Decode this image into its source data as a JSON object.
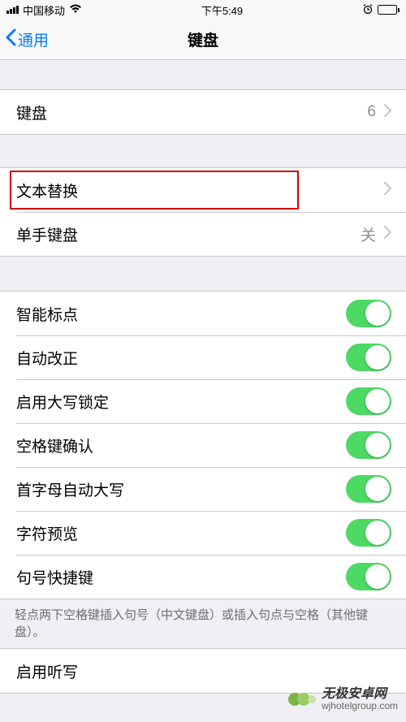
{
  "status_bar": {
    "carrier": "中国移动",
    "time": "下午5:49"
  },
  "nav": {
    "back_label": "通用",
    "title": "键盘"
  },
  "group1": {
    "keyboards": {
      "label": "键盘",
      "value": "6"
    }
  },
  "group2": {
    "text_replace": {
      "label": "文本替换"
    },
    "one_handed": {
      "label": "单手键盘",
      "value": "关"
    }
  },
  "group3": {
    "items": [
      {
        "label": "智能标点"
      },
      {
        "label": "自动改正"
      },
      {
        "label": "启用大写锁定"
      },
      {
        "label": "空格键确认"
      },
      {
        "label": "首字母自动大写"
      },
      {
        "label": "字符预览"
      },
      {
        "label": "句号快捷键"
      }
    ]
  },
  "footer_note": "轻点两下空格键插入句号（中文键盘）或插入句点与空格（其他键盘）。",
  "group4": {
    "dictation": {
      "label": "启用听写"
    }
  },
  "watermark": {
    "title": "无极安卓网",
    "sub": "wjhotelgroup.com"
  }
}
